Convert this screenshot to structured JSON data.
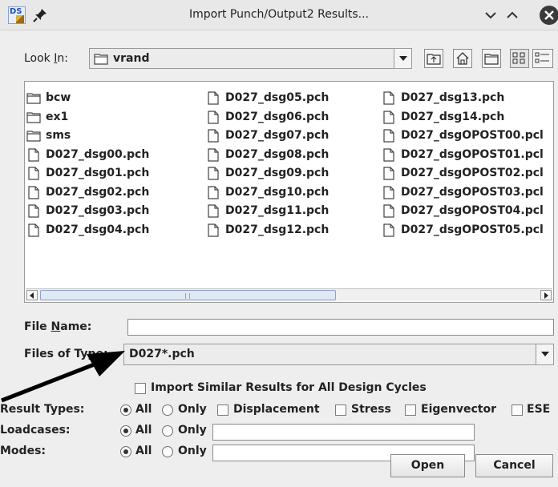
{
  "window": {
    "title": "Import Punch/Output2 Results...",
    "app_icon_text": "DS"
  },
  "look_in": {
    "label_prefix": "Look ",
    "label_mnemonic": "I",
    "label_suffix": "n:",
    "value": "vrand"
  },
  "files": [
    {
      "name": "bcw",
      "type": "folder"
    },
    {
      "name": "ex1",
      "type": "folder"
    },
    {
      "name": "sms",
      "type": "folder"
    },
    {
      "name": "D027_dsg00.pch",
      "type": "file"
    },
    {
      "name": "D027_dsg01.pch",
      "type": "file"
    },
    {
      "name": "D027_dsg02.pch",
      "type": "file"
    },
    {
      "name": "D027_dsg03.pch",
      "type": "file"
    },
    {
      "name": "D027_dsg04.pch",
      "type": "file"
    },
    {
      "name": "D027_dsg05.pch",
      "type": "file"
    },
    {
      "name": "D027_dsg06.pch",
      "type": "file"
    },
    {
      "name": "D027_dsg07.pch",
      "type": "file"
    },
    {
      "name": "D027_dsg08.pch",
      "type": "file"
    },
    {
      "name": "D027_dsg09.pch",
      "type": "file"
    },
    {
      "name": "D027_dsg10.pch",
      "type": "file"
    },
    {
      "name": "D027_dsg11.pch",
      "type": "file"
    },
    {
      "name": "D027_dsg12.pch",
      "type": "file"
    },
    {
      "name": "D027_dsg13.pch",
      "type": "file"
    },
    {
      "name": "D027_dsg14.pch",
      "type": "file"
    },
    {
      "name": "D027_dsgOPOST00.pcl",
      "type": "file"
    },
    {
      "name": "D027_dsgOPOST01.pcl",
      "type": "file"
    },
    {
      "name": "D027_dsgOPOST02.pcl",
      "type": "file"
    },
    {
      "name": "D027_dsgOPOST03.pcl",
      "type": "file"
    },
    {
      "name": "D027_dsgOPOST04.pcl",
      "type": "file"
    },
    {
      "name": "D027_dsgOPOST05.pcl",
      "type": "file"
    }
  ],
  "file_name": {
    "label_prefix": "File ",
    "label_mnemonic": "N",
    "label_suffix": "ame:",
    "value": ""
  },
  "files_of_type": {
    "label": "Files of Type:",
    "value": "D027*.pch"
  },
  "import_similar": {
    "label": "Import Similar Results for All Design Cycles",
    "checked": false
  },
  "result_types": {
    "label": "Result Types:",
    "all_label": "All",
    "only_label": "Only",
    "selected": "All",
    "options": [
      "Displacement",
      "Stress",
      "Eigenvector",
      "ESE"
    ]
  },
  "loadcases": {
    "label": "Loadcases:",
    "all_label": "All",
    "only_label": "Only",
    "selected": "All",
    "value": ""
  },
  "modes": {
    "label": "Modes:",
    "all_label": "All",
    "only_label": "Only",
    "selected": "All",
    "value": ""
  },
  "buttons": {
    "open": "Open",
    "cancel": "Cancel"
  },
  "colors": {
    "annotation_arrow": "#000000",
    "window_bg": "#eeeeee",
    "scroll_thumb": "#dfe8f5"
  }
}
